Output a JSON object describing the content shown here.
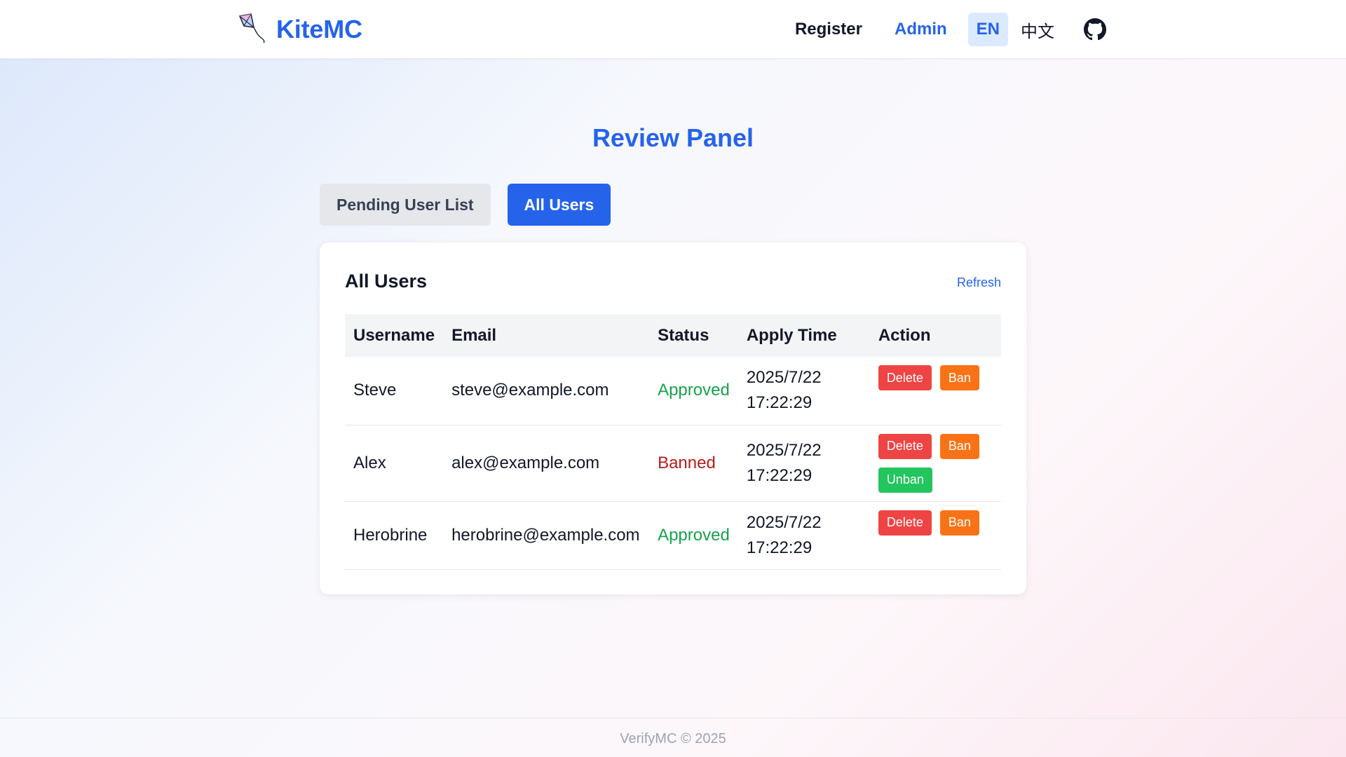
{
  "header": {
    "brand_name": "KiteMC",
    "logo_icon": "kite-icon",
    "nav": {
      "register_label": "Register",
      "admin_label": "Admin",
      "lang_en": "EN",
      "lang_zh": "中文",
      "github_icon": "github-icon"
    }
  },
  "main": {
    "title": "Review Panel",
    "tabs": [
      {
        "label": "Pending User List",
        "active": false
      },
      {
        "label": "All Users",
        "active": true
      }
    ],
    "card": {
      "title": "All Users",
      "refresh_label": "Refresh",
      "columns": [
        "Username",
        "Email",
        "Status",
        "Apply Time",
        "Action"
      ],
      "rows": [
        {
          "username": "Steve",
          "email": "steve@example.com",
          "status": "Approved",
          "time_date": "2025/7/22",
          "time_clock": "17:22:29",
          "actions": [
            "Delete",
            "Ban"
          ]
        },
        {
          "username": "Alex",
          "email": "alex@example.com",
          "status": "Banned",
          "time_date": "2025/7/22",
          "time_clock": "17:22:29",
          "actions": [
            "Delete",
            "Ban",
            "Unban"
          ]
        },
        {
          "username": "Herobrine",
          "email": "herobrine@example.com",
          "status": "Approved",
          "time_date": "2025/7/22",
          "time_clock": "17:22:29",
          "actions": [
            "Delete",
            "Ban"
          ]
        }
      ]
    }
  },
  "footer": {
    "text": "VerifyMC © 2025"
  },
  "colors": {
    "accent": "#2563eb",
    "approved": "#16a34a",
    "banned": "#b91c1c",
    "delete": "#ef4444",
    "ban": "#f97316",
    "unban": "#22c55e"
  }
}
